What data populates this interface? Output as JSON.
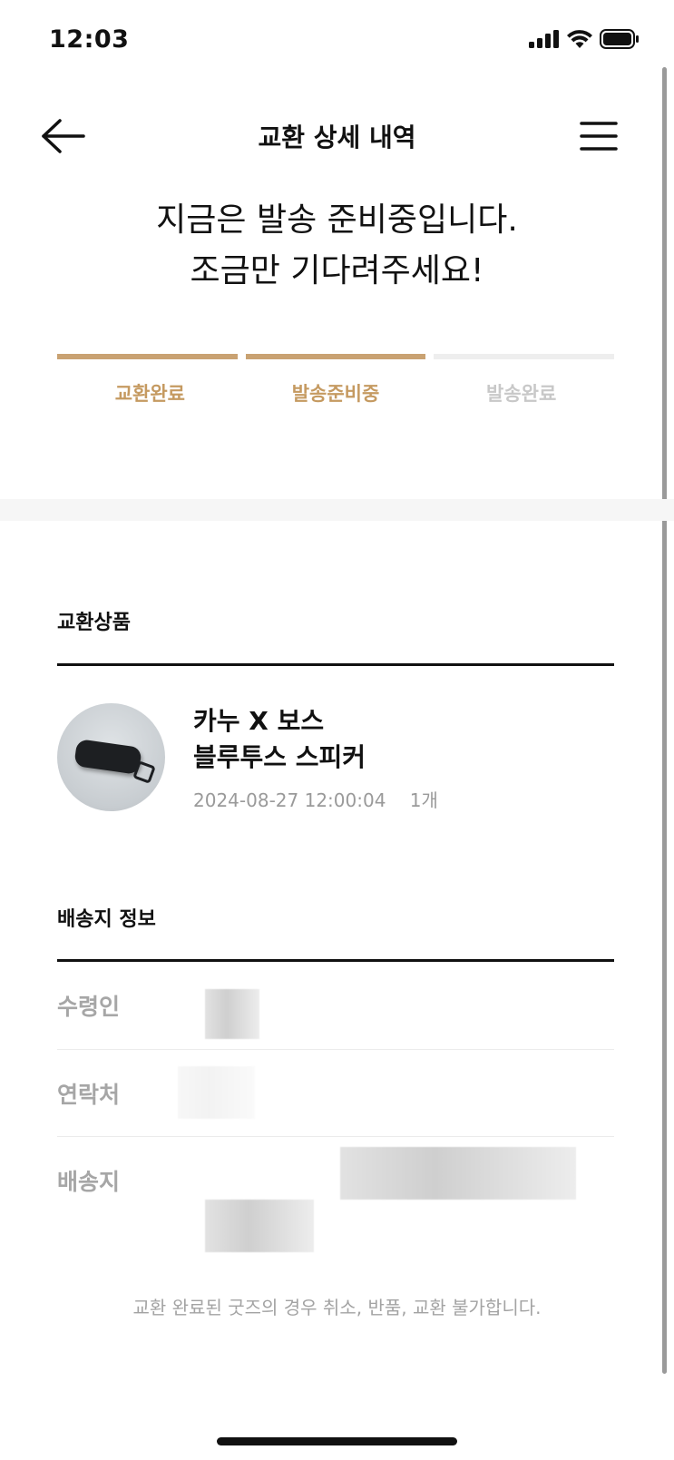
{
  "status_bar": {
    "time": "12:03"
  },
  "nav": {
    "title": "교환 상세 내역"
  },
  "headline": {
    "line1": "지금은 발송 준비중입니다.",
    "line2": "조금만 기다려주세요!"
  },
  "progress": {
    "steps": [
      {
        "label": "교환완료",
        "state": "done"
      },
      {
        "label": "발송준비중",
        "state": "done"
      },
      {
        "label": "발송완료",
        "state": "pending"
      }
    ],
    "accent_color": "#c9a272",
    "inactive_color": "#c8c8c8"
  },
  "product_section": {
    "title": "교환상품",
    "product": {
      "name_line1": "카누 X 보스",
      "name_line2": "블루투스 스피커",
      "date": "2024-08-27 12:00:04",
      "quantity": "1개"
    }
  },
  "shipping_section": {
    "title": "배송지 정보",
    "rows": [
      {
        "label": "수령인"
      },
      {
        "label": "연락처"
      },
      {
        "label": "배송지"
      }
    ]
  },
  "notice": "교환 완료된 굿즈의 경우 취소, 반품, 교환 불가합니다."
}
